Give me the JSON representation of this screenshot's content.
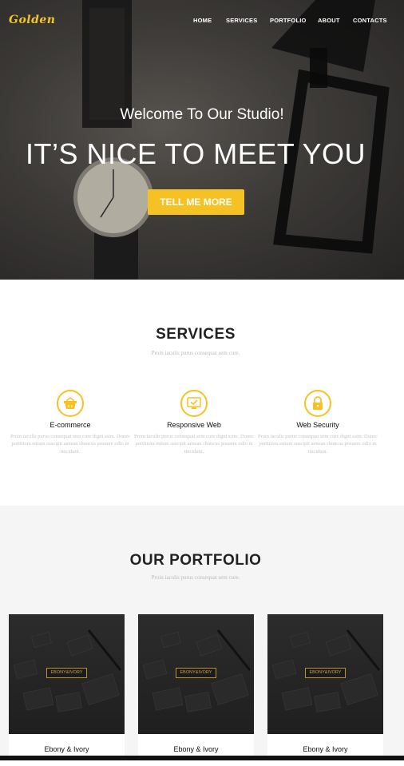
{
  "brand": {
    "logo": "Golden",
    "accent": "#f6c223"
  },
  "nav": {
    "items": [
      "HOME",
      "SERVICES",
      "PORTFOLIO",
      "ABOUT",
      "CONTACTS"
    ]
  },
  "hero": {
    "welcome": "Welcome To Our Studio!",
    "headline": "IT’S NICE TO MEET YOU",
    "cta": "TELL ME MORE"
  },
  "services": {
    "title": "SERVICES",
    "subtitle": "Proin iaculis purus consequat sem cure.",
    "items": [
      {
        "icon": "basket-icon",
        "name": "E-commerce",
        "desc": "Proin iaculis purus consequat sem cure digni ssim. Donec porttitora entum suscipit aenean rhoncus posuere odio in tincidunt."
      },
      {
        "icon": "monitor-check-icon",
        "name": "Responsive Web",
        "desc": "Proin iaculis purus consequat sem cure digni ssim. Donec porttitora entum suscipit aenean rhoncus posuere odio in tincidunt."
      },
      {
        "icon": "lock-icon",
        "name": "Web Security",
        "desc": "Proin iaculis purus consequat sem cure digni ssim. Donec porttitora entum suscipit aenean rhoncus posuere odio in tincidunt."
      }
    ]
  },
  "portfolio": {
    "title": "OUR PORTFOLIO",
    "subtitle": "Proin iaculis purus consequat sem cure.",
    "items": [
      {
        "caption": "Ebony & Ivory",
        "tag": "EBONY&IVORY"
      },
      {
        "caption": "Ebony & Ivory",
        "tag": "EBONY&IVORY"
      },
      {
        "caption": "Ebony & Ivory",
        "tag": "EBONY&IVORY"
      }
    ]
  }
}
